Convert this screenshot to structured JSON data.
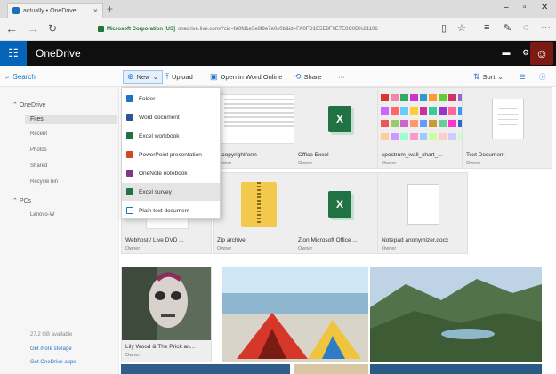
{
  "browser": {
    "tab_title": "actually • OneDrive",
    "tab_close": "×",
    "new_tab": "+",
    "url_org": "Microsoft Corporation [US]",
    "url_rest": "onedrive.live.com/?cid=fa0fd1e5e8f9e7e0c0b&id=FA0FD1E5E8F9E7E0C0B%21106"
  },
  "header": {
    "app_name": "OneDrive"
  },
  "commandbar": {
    "search": "Search",
    "new": "New",
    "upload": "Upload",
    "open_word": "Open in Word Online",
    "share": "Share",
    "more": "···",
    "sort": "Sort"
  },
  "new_menu": {
    "items": [
      {
        "label": "Folder",
        "color": "#1f73c4"
      },
      {
        "label": "Word document",
        "color": "#2b579a"
      },
      {
        "label": "Excel workbook",
        "color": "#207245"
      },
      {
        "label": "PowerPoint presentation",
        "color": "#d24726"
      },
      {
        "label": "OneNote notebook",
        "color": "#80397b"
      },
      {
        "label": "Excel survey",
        "color": "#207245"
      },
      {
        "label": "Plain text document",
        "color": "#1f73c4"
      }
    ]
  },
  "sidebar": {
    "onedrive": "OneDrive",
    "items": [
      "Files",
      "Recent",
      "Photos",
      "Shared",
      "Recycle bin"
    ],
    "pcs": "PCs",
    "pc_items": [
      "Lenovo-W"
    ],
    "storage": "27.2 GB available",
    "get_more": "Get more storage",
    "get_apps": "Get OneDrive apps"
  },
  "files": [
    {
      "name": "...copyrightform",
      "owner": "Owner"
    },
    {
      "name": "Office Excel",
      "owner": "Owner"
    },
    {
      "name": "spectrum_wall_chart_...",
      "owner": "Owner"
    },
    {
      "name": "Text Document",
      "owner": "Owner"
    },
    {
      "name": "Webhost / Live DVD ...",
      "owner": "Owner"
    },
    {
      "name": "Zip archive",
      "owner": "Owner"
    },
    {
      "name": "Zion Microsoft Office ...",
      "owner": "Owner"
    },
    {
      "name": "Notepad anonymizer.docx",
      "owner": "Owner"
    },
    {
      "name": "Lily Wood & The Prick an...",
      "owner": "Owner"
    }
  ],
  "colors": {
    "brand_blue": "#0364b8",
    "header_black": "#0f0f0f",
    "excel_green": "#207245",
    "link_blue": "#1f73c4"
  }
}
